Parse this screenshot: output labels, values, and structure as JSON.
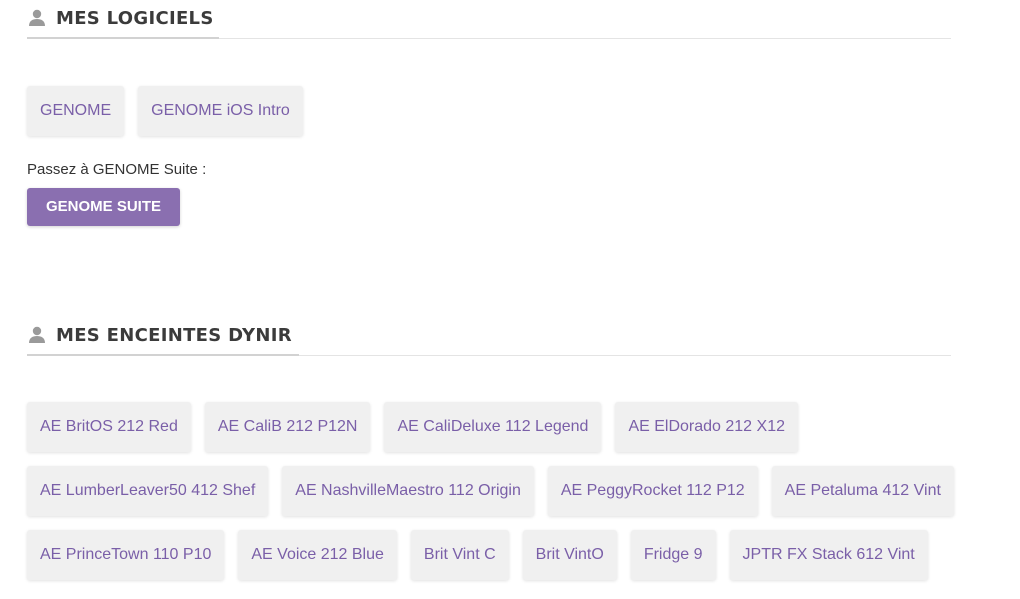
{
  "sections": {
    "software": {
      "title": "MES LOGICIELS",
      "items": [
        {
          "label": "GENOME"
        },
        {
          "label": "GENOME iOS Intro"
        }
      ],
      "upgrade_text": "Passez à GENOME Suite :",
      "upgrade_button": "GENOME SUITE"
    },
    "speakers": {
      "title": "MES ENCEINTES DYNIR",
      "rows": [
        [
          "AE BritOS 212 Red",
          "AE CaliB 212 P12N",
          "AE CaliDeluxe 112 Legend",
          "AE ElDorado 212 X12"
        ],
        [
          "AE LumberLeaver50 412 Shef",
          "AE NashvilleMaestro 112 Origin",
          "AE PeggyRocket 112 P12",
          "AE Petaluma 412 Vint"
        ],
        [
          "AE PrinceTown 110 P10",
          "AE Voice 212 Blue",
          "Brit Vint C",
          "Brit VintO",
          "Fridge 9",
          "JPTR FX Stack 612 Vint"
        ]
      ]
    }
  },
  "colors": {
    "accent": "#8a6fb0",
    "chip_text": "#7a5fa8",
    "chip_bg": "#f0f0f0"
  },
  "icons": {
    "section": "user-icon"
  }
}
